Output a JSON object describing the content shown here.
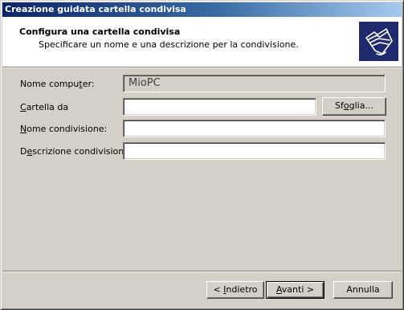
{
  "window": {
    "title": "Creazione guidata cartella condivisa"
  },
  "header": {
    "title": "Configura una cartella condivisa",
    "subtitle": "Specificare un nome e una descrizione per la condivisione.",
    "icon": "shared-folder-wizard-icon"
  },
  "form": {
    "computer_name": {
      "label_pre": "Nome compu",
      "label_accel": "t",
      "label_post": "er:",
      "value": "MioPC"
    },
    "folder_path": {
      "label_pre": "",
      "label_accel": "C",
      "label_post": "artella da",
      "value": ""
    },
    "share_name": {
      "label_pre": "",
      "label_accel": "N",
      "label_post": "ome condivisione:",
      "value": ""
    },
    "share_description": {
      "label_pre": "D",
      "label_accel": "e",
      "label_post": "scrizione condivisione:",
      "value": ""
    },
    "browse_button": {
      "label_pre": "Sf",
      "label_accel": "o",
      "label_post": "glia..."
    }
  },
  "footer": {
    "back_button": {
      "label_pre": "< ",
      "label_accel": "I",
      "label_post": "ndietro"
    },
    "next_button": {
      "label_pre": "",
      "label_accel": "A",
      "label_post": "vanti >"
    },
    "cancel_button": {
      "label": "Annulla"
    }
  },
  "colors": {
    "title_bar_start": "#0a246a",
    "title_bar_end": "#a6caf0",
    "dialog_face": "#d4d0c8",
    "header_background": "#ffffff",
    "icon_background": "#1e2a6e"
  }
}
